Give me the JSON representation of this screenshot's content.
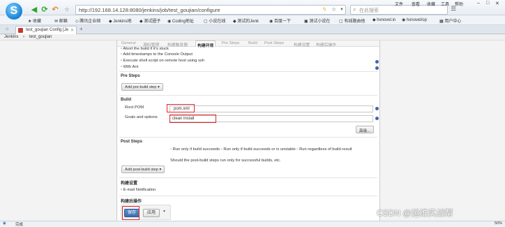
{
  "browser": {
    "logo": "S",
    "url": "http://192.168.14.128:8080/jenkins/job/test_goujian/configure",
    "search_placeholder": "在此搜索",
    "sys_menu": [
      "文件",
      "查看",
      "收藏",
      "工具",
      "帮助"
    ]
  },
  "bookmarks": [
    "收藏",
    "邮箱",
    "腾讯企业邮",
    "Jenkins地",
    "测试圈子",
    "Coding地址",
    "小说在线",
    "测试的Jenk",
    "百度一下",
    "测试小说在",
    "有线路由他",
    "hxnovel.in",
    "hxnovel/op",
    "用户中心"
  ],
  "tab": {
    "title": "test_goujian Config [Je",
    "new_tab": "+"
  },
  "breadcrumb": [
    "Jenkins",
    "test_goujian"
  ],
  "config_tabs": [
    "General",
    "源码管理",
    "构建触发器",
    "构建环境",
    "Pre Steps",
    "Build",
    "Post Steps",
    "构建设置",
    "构建后操作"
  ],
  "env_options": [
    "Abort the build if it's stuck",
    "Add timestamps to the Console Output",
    "Execute shell script on remote host using ssh",
    "With Ant"
  ],
  "pre_steps": {
    "title": "Pre Steps",
    "button": "Add pre-build step"
  },
  "build": {
    "title": "Build",
    "root_pom_label": "Root POM",
    "root_pom_value": "pom.xml",
    "goals_label": "Goals and options",
    "goals_value": "clean install",
    "advanced_button": "高级..."
  },
  "post_steps": {
    "title": "Post Steps",
    "options": [
      "Run only if build succeeds",
      "Run only if build succeeds or is unstable",
      "Run regardless of build result"
    ],
    "note": "Should the post-build steps run only for successful builds, etc.",
    "button": "Add post-build step"
  },
  "build_settings": {
    "title": "构建设置",
    "email": "E-mail Notification"
  },
  "post_build": {
    "title": "构建后操作"
  },
  "actions": {
    "save": "保存",
    "apply": "应用"
  },
  "status": {
    "left": "完成",
    "zoom": "50%"
  },
  "watermark": "CSDN @运维实战帮"
}
